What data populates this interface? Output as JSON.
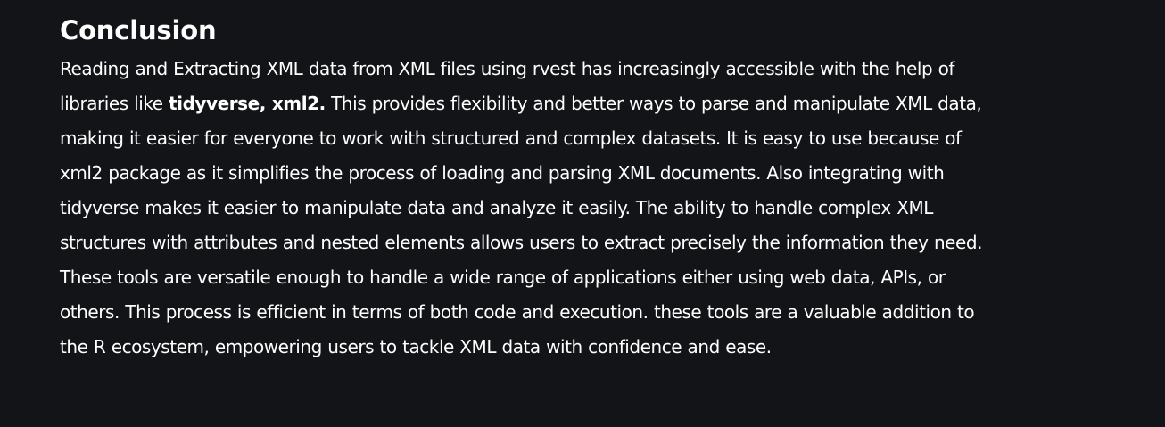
{
  "section": {
    "title": "Conclusion",
    "paragraph": {
      "part1": "Reading and Extracting XML data from XML files using rvest has increasingly accessible with the help of libraries like ",
      "bold": "tidyverse, xml2.",
      "part2": " This provides flexibility and better ways to parse and manipulate XML data, making it easier for everyone to work with structured and complex datasets. It is easy to use because of xml2 package as it simplifies the process of loading and parsing XML documents. Also integrating with tidyverse makes it easier to manipulate data and analyze it easily. The ability to handle complex XML structures with attributes and nested elements allows users to extract precisely the information they need. These tools are versatile enough to handle a wide range of applications either using web data, APIs, or others. This process is efficient in terms of both code and execution. these tools are a valuable addition to the R ecosystem, empowering users to tackle XML data with confidence and ease."
    }
  }
}
